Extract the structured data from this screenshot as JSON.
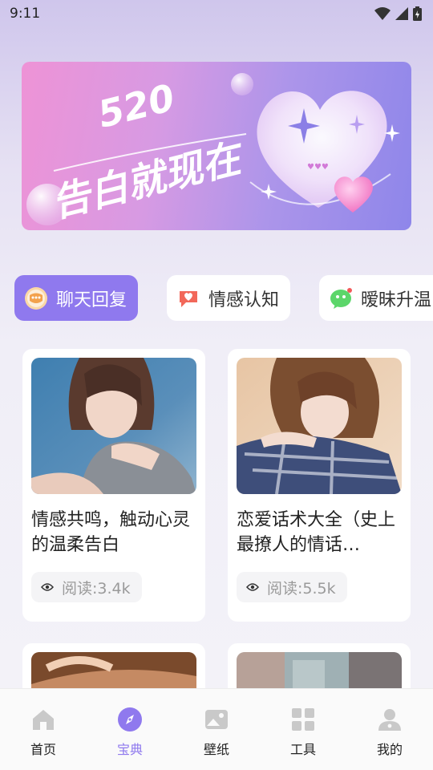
{
  "status_bar": {
    "time": "9:11"
  },
  "banner": {
    "number": "520",
    "slogan": "告白就现在"
  },
  "chips": [
    {
      "label": "聊天回复",
      "icon": "chat-bubble-icon",
      "active": true
    },
    {
      "label": "情感认知",
      "icon": "heart-message-icon",
      "active": false
    },
    {
      "label": "暧昧升温",
      "icon": "wechat-bubble-icon",
      "active": false
    }
  ],
  "cards": [
    {
      "title": "情感共鸣，触动心灵的温柔告白",
      "views": "阅读:3.4k"
    },
    {
      "title": "恋爱话术大全（史上最撩人的情话…",
      "views": "阅读:5.5k"
    }
  ],
  "nav": [
    {
      "label": "首页",
      "icon": "home-icon"
    },
    {
      "label": "宝典",
      "icon": "compass-icon",
      "active": true
    },
    {
      "label": "壁纸",
      "icon": "wallpaper-icon"
    },
    {
      "label": "工具",
      "icon": "grid-tools-icon"
    },
    {
      "label": "我的",
      "icon": "profile-icon"
    }
  ],
  "colors": {
    "accent": "#8f79ee",
    "nav_inactive_icon": "#c9c9c9"
  }
}
